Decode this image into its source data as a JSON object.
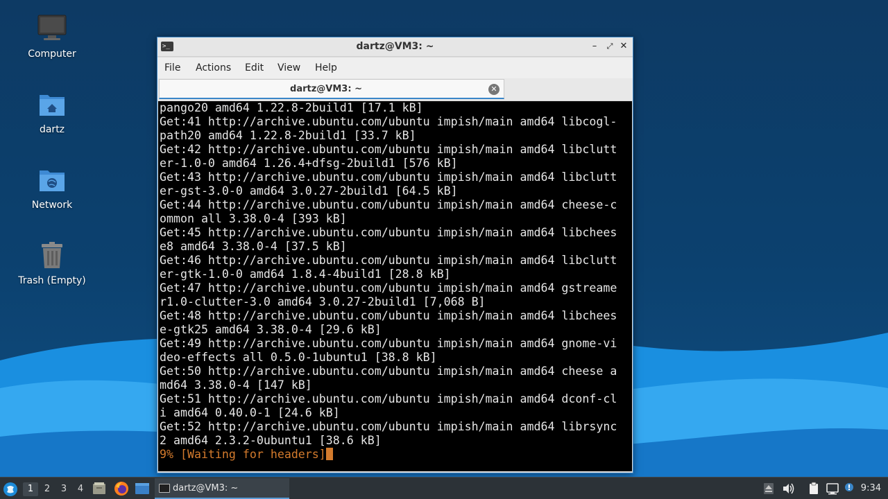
{
  "desktop": {
    "icons": [
      {
        "label": "Computer",
        "icon": "computer-icon"
      },
      {
        "label": "dartz",
        "icon": "home-folder-icon"
      },
      {
        "label": "Network",
        "icon": "network-folder-icon"
      },
      {
        "label": "Trash (Empty)",
        "icon": "trash-icon"
      }
    ]
  },
  "window": {
    "title": "dartz@VM3: ~",
    "menu": [
      "File",
      "Actions",
      "Edit",
      "View",
      "Help"
    ],
    "tab_title": "dartz@VM3: ~",
    "controls": [
      "minimize-icon",
      "maximize-icon",
      "close-icon"
    ]
  },
  "terminal": {
    "lines": [
      "pango20 amd64 1.22.8-2build1 [17.1 kB]",
      "Get:41 http://archive.ubuntu.com/ubuntu impish/main amd64 libcogl-",
      "path20 amd64 1.22.8-2build1 [33.7 kB]",
      "Get:42 http://archive.ubuntu.com/ubuntu impish/main amd64 libclutt",
      "er-1.0-0 amd64 1.26.4+dfsg-2build1 [576 kB]",
      "Get:43 http://archive.ubuntu.com/ubuntu impish/main amd64 libclutt",
      "er-gst-3.0-0 amd64 3.0.27-2build1 [64.5 kB]",
      "Get:44 http://archive.ubuntu.com/ubuntu impish/main amd64 cheese-c",
      "ommon all 3.38.0-4 [393 kB]",
      "Get:45 http://archive.ubuntu.com/ubuntu impish/main amd64 libchees",
      "e8 amd64 3.38.0-4 [37.5 kB]",
      "Get:46 http://archive.ubuntu.com/ubuntu impish/main amd64 libclutt",
      "er-gtk-1.0-0 amd64 1.8.4-4build1 [28.8 kB]",
      "Get:47 http://archive.ubuntu.com/ubuntu impish/main amd64 gstreame",
      "r1.0-clutter-3.0 amd64 3.0.27-2build1 [7,068 B]",
      "Get:48 http://archive.ubuntu.com/ubuntu impish/main amd64 libchees",
      "e-gtk25 amd64 3.38.0-4 [29.6 kB]",
      "Get:49 http://archive.ubuntu.com/ubuntu impish/main amd64 gnome-vi",
      "deo-effects all 0.5.0-1ubuntu1 [38.8 kB]",
      "Get:50 http://archive.ubuntu.com/ubuntu impish/main amd64 cheese a",
      "md64 3.38.0-4 [147 kB]",
      "Get:51 http://archive.ubuntu.com/ubuntu impish/main amd64 dconf-cl",
      "i amd64 0.40.0-1 [24.6 kB]",
      "Get:52 http://archive.ubuntu.com/ubuntu impish/main amd64 librsync",
      "2 amd64 2.3.2-0ubuntu1 [38.6 kB]"
    ],
    "status_line": "9% [Waiting for headers]"
  },
  "taskbar": {
    "workspaces": [
      "1",
      "2",
      "3",
      "4"
    ],
    "active_workspace": "1",
    "task_label": "dartz@VM3: ~",
    "clock": "9:34"
  },
  "colors": {
    "accent": "#3a86c8",
    "terminal_bg": "#000000",
    "terminal_fg": "#e6e6e6",
    "status_fg": "#d47b2d"
  }
}
